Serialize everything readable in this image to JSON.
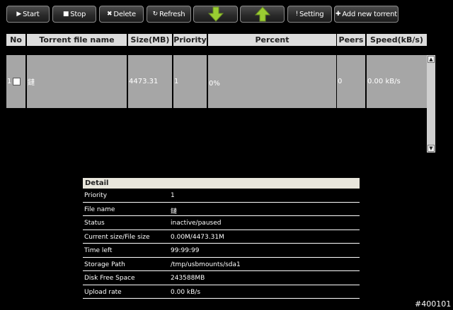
{
  "toolbar": {
    "start": "Start",
    "stop": "Stop",
    "delete": "Delete",
    "refresh": "Refresh",
    "move_down_icon": "green-down-arrow",
    "move_up_icon": "green-up-arrow",
    "setting": "Setting",
    "add": "Add new torrent"
  },
  "table": {
    "headers": [
      "No",
      "Torrent file name",
      "Size(MB)",
      "Priority",
      "Percent",
      "Peers",
      "Speed(kB/s)"
    ],
    "rows": [
      {
        "no": "1",
        "name": "鏈",
        "size": "4473.31",
        "priority": "1",
        "percent": "0%",
        "peers": "0",
        "speed": "0.00 kB/s"
      }
    ]
  },
  "detail": {
    "title": "Detail",
    "rows": [
      {
        "label": "Priority",
        "value": "1"
      },
      {
        "label": "File name",
        "value": "鏈"
      },
      {
        "label": "Status",
        "value": "inactive/paused"
      },
      {
        "label": "Current size/File size",
        "value": "0.00M/4473.31M"
      },
      {
        "label": "Time left",
        "value": "99:99:99"
      },
      {
        "label": "Storage Path",
        "value": "/tmp/usbmounts/sda1"
      },
      {
        "label": "Disk Free Space",
        "value": "243588MB"
      },
      {
        "label": "Upload rate",
        "value": "0.00 kB/s"
      }
    ]
  },
  "footer_tag": "#400101",
  "colors": {
    "accent_green": "#9acd32",
    "header_bg": "#dcdcdc",
    "row_bg": "#a6a6a6"
  }
}
